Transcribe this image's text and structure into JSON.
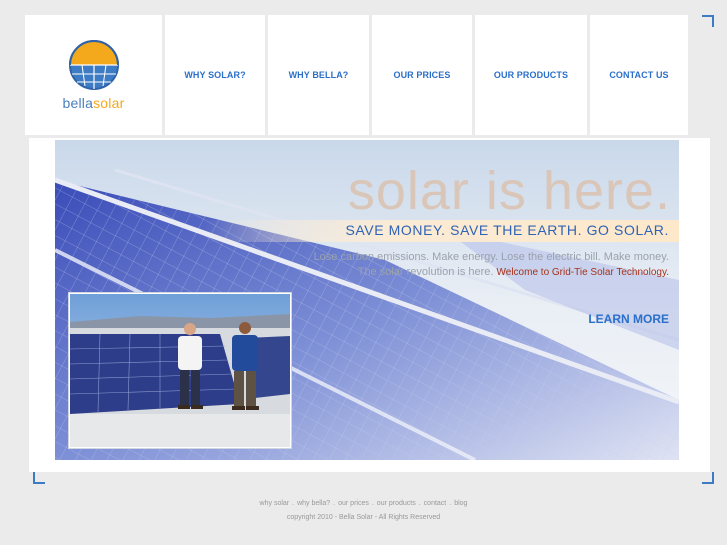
{
  "brand": {
    "logo_part1": "bella",
    "logo_part2": "solar",
    "colors": {
      "blue": "#3d7cc4",
      "orange": "#f4a81c",
      "nav_text": "#2a6fc9",
      "accent_red": "#a5321b"
    }
  },
  "nav": {
    "items": [
      {
        "label": "WHY SOLAR?"
      },
      {
        "label": "WHY BELLA?"
      },
      {
        "label": "OUR PRICES"
      },
      {
        "label": "OUR PRODUCTS"
      },
      {
        "label": "CONTACT US"
      }
    ]
  },
  "hero": {
    "headline": "solar is here.",
    "tagline": "SAVE MONEY.   SAVE THE EARTH.   GO SOLAR.",
    "body_line1": "Lose carbon emissions. Make energy. Lose the electric bill. Make money.",
    "body_line2": "The solar revolution is here.",
    "body_accent": "Welcome to Grid-Tie Solar Technology.",
    "cta": "LEARN MORE"
  },
  "footer": {
    "links": [
      "why solar",
      "why bella?",
      "our prices",
      "our products",
      "contact",
      "blog"
    ],
    "separator": ".",
    "copyright": "copyright 2010 - Bella Solar - All Rights Reserved"
  }
}
